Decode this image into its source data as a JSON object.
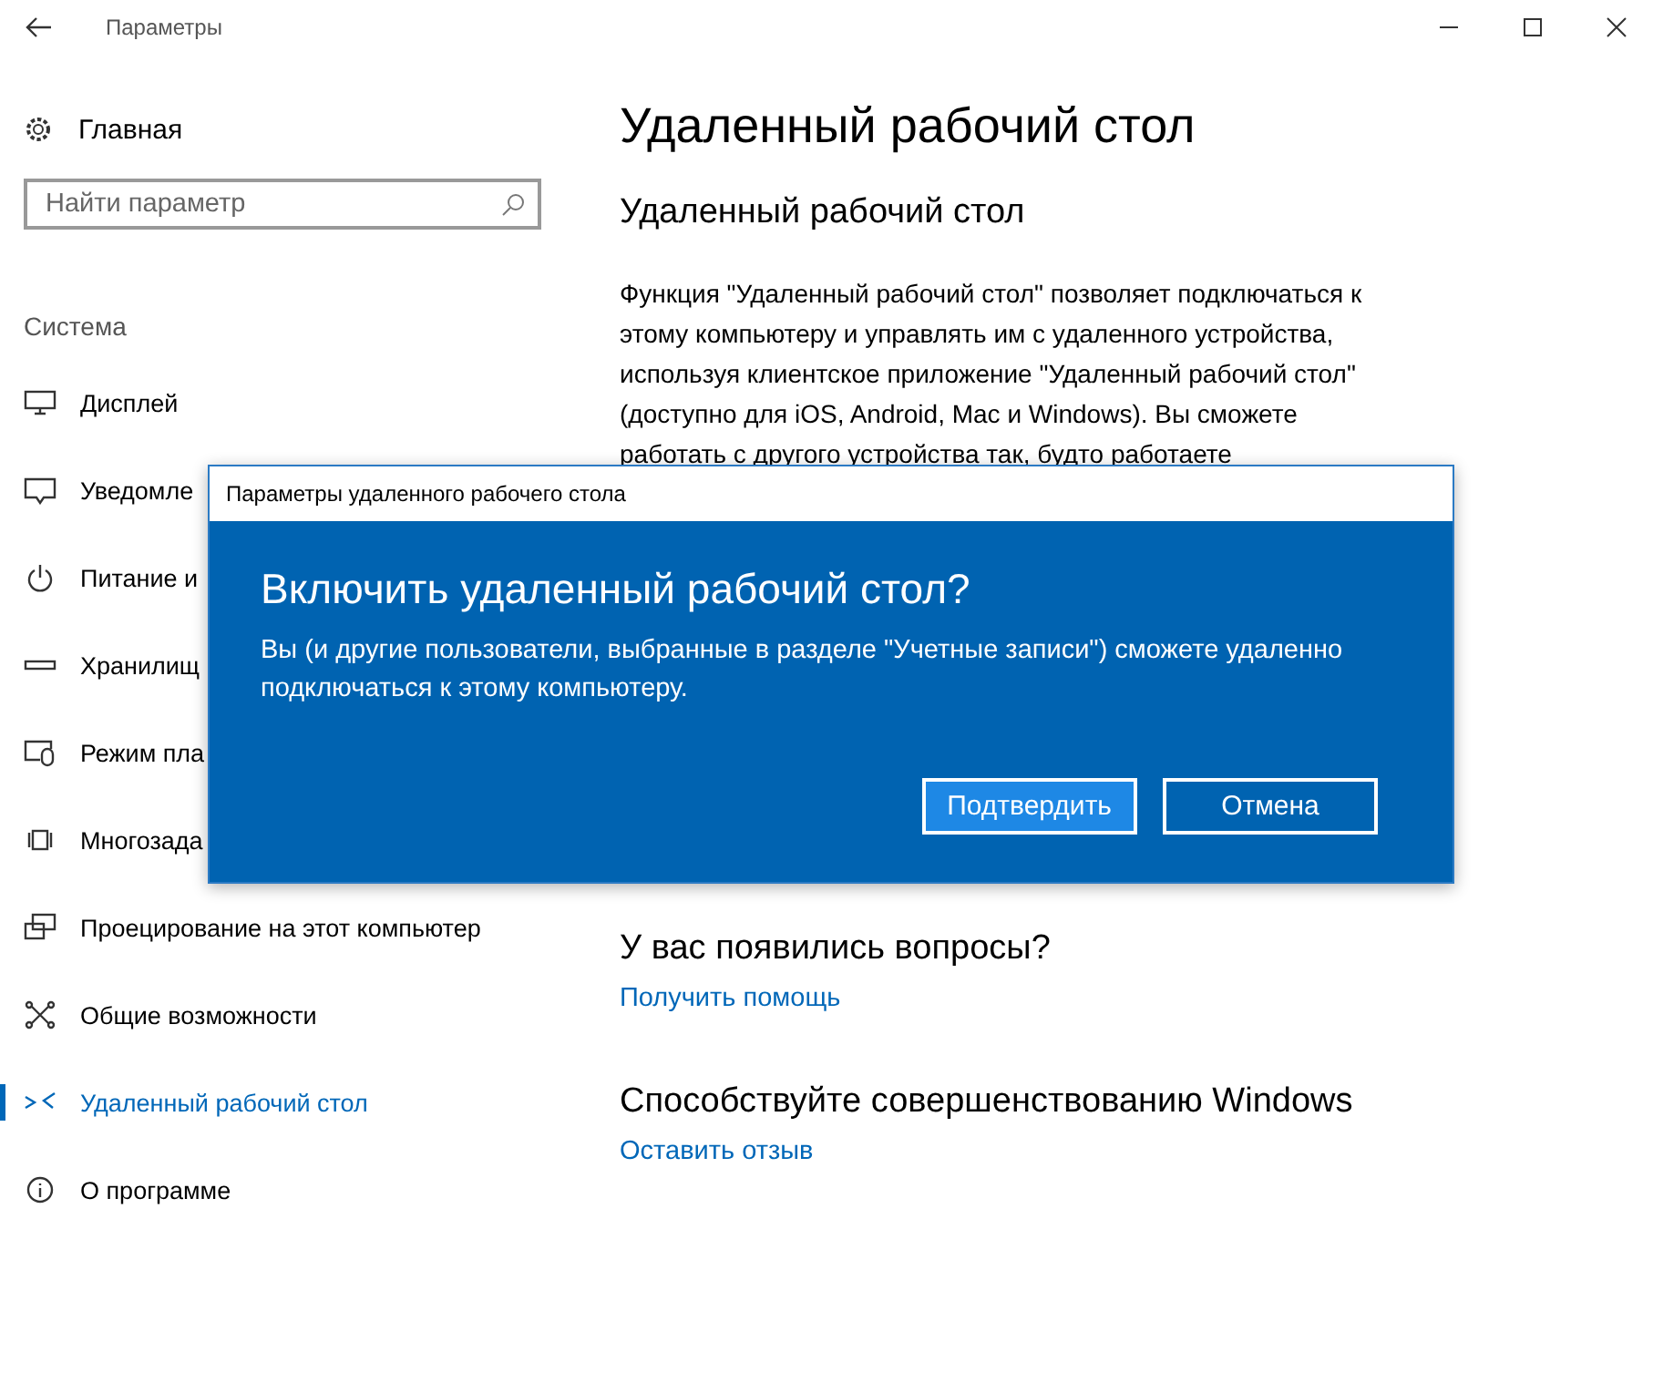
{
  "window": {
    "title": "Параметры"
  },
  "sidebar": {
    "home": "Главная",
    "search": {
      "placeholder": "Найти параметр"
    },
    "section": "Система",
    "items": [
      {
        "label": "Дисплей",
        "selected": false
      },
      {
        "label": "Уведомле",
        "selected": false
      },
      {
        "label": "Питание и",
        "selected": false
      },
      {
        "label": "Хранилищ",
        "selected": false
      },
      {
        "label": "Режим пла",
        "selected": false
      },
      {
        "label": "Многозада",
        "selected": false
      },
      {
        "label": "Проецирование на этот компьютер",
        "selected": false
      },
      {
        "label": "Общие возможности",
        "selected": false
      },
      {
        "label": "Удаленный рабочий стол",
        "selected": true
      },
      {
        "label": "О программе",
        "selected": false
      }
    ]
  },
  "content": {
    "title": "Удаленный рабочий стол",
    "subtitle": "Удаленный рабочий стол",
    "description": "Функция \"Удаленный рабочий стол\" позволяет подключаться к этому компьютеру и управлять им с удаленного устройства, используя клиентское приложение \"Удаленный рабочий стол\" (доступно для iOS, Android, Mac и Windows). Вы сможете работать с другого устройства так, будто работаете",
    "sections": [
      {
        "heading": "У вас появились вопросы?",
        "link": "Получить помощь"
      },
      {
        "heading": "Способствуйте совершенствованию Windows",
        "link": "Оставить отзыв"
      }
    ]
  },
  "dialog": {
    "title": "Параметры удаленного рабочего стола",
    "heading": "Включить удаленный рабочий стол?",
    "message": "Вы (и другие пользователи, выбранные в разделе \"Учетные записи\") сможете удаленно подключаться к этому компьютеру.",
    "buttons": [
      {
        "label": "Подтвердить",
        "primary": true
      },
      {
        "label": "Отмена",
        "primary": false
      }
    ]
  }
}
